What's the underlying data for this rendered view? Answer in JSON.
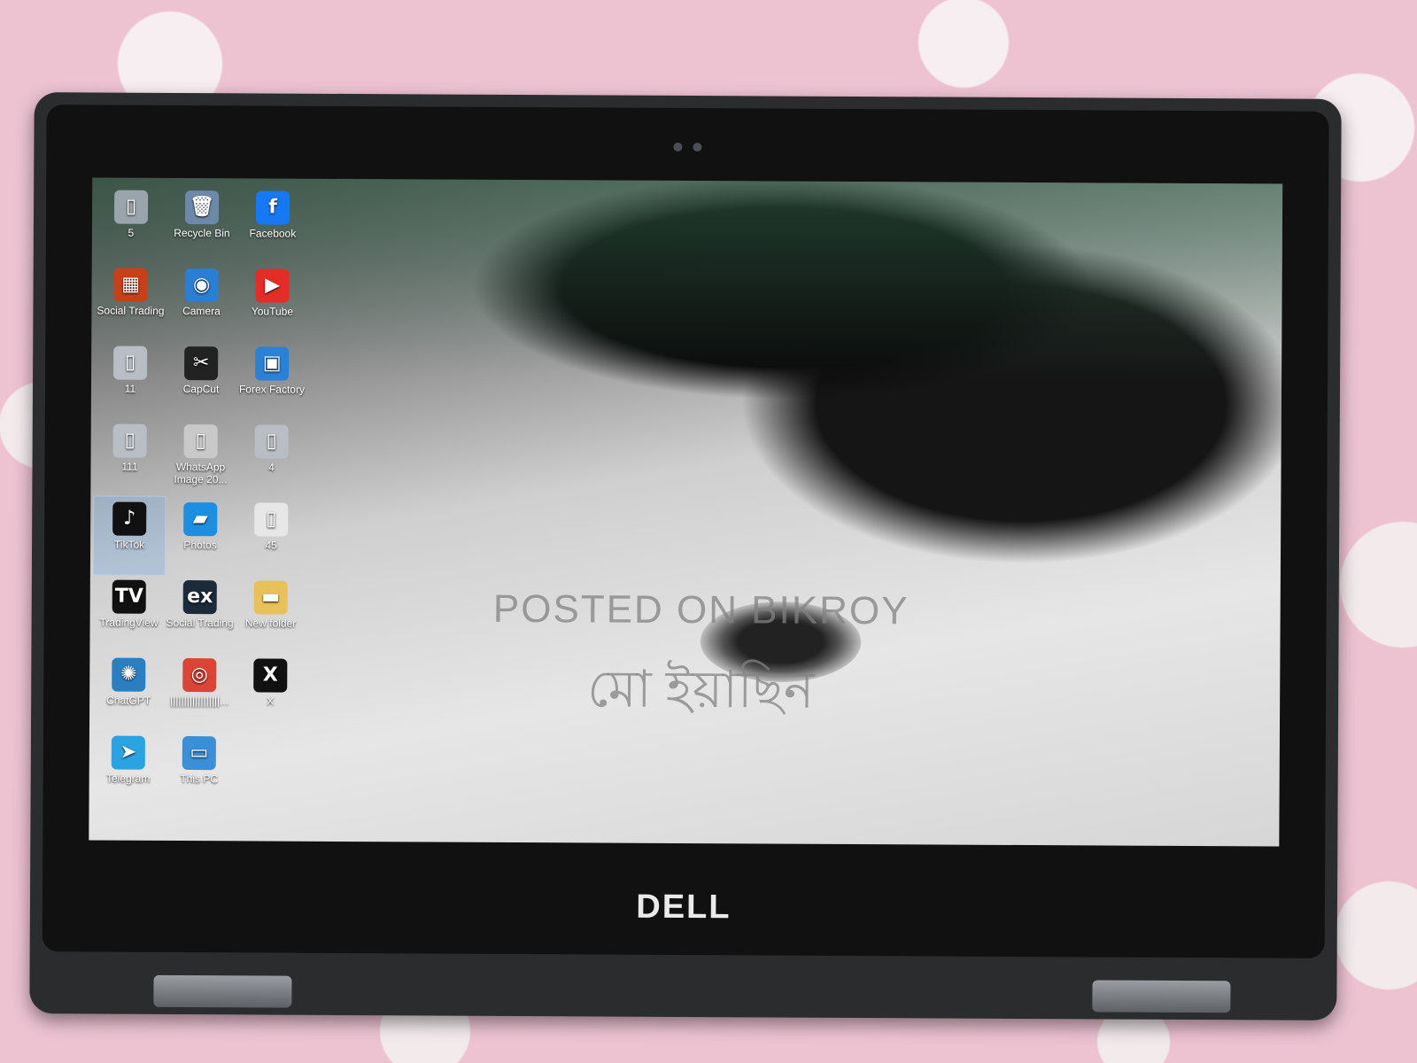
{
  "watermark": {
    "line1": "POSTED ON BIKROY",
    "line2": "মো ইয়াছিন"
  },
  "brand": {
    "logo": "DELL"
  },
  "desktop": {
    "icons": [
      {
        "label": "5",
        "icon": "file-icon",
        "color": "#9aa4ad",
        "glyph": "▯"
      },
      {
        "label": "Recycle Bin",
        "icon": "recycle-bin-icon",
        "color": "#6d88a8",
        "glyph": "🗑"
      },
      {
        "label": "Facebook",
        "icon": "facebook-icon",
        "color": "#1877f2",
        "glyph": "f"
      },
      {
        "label": "Social Trading",
        "icon": "social-trading-icon",
        "color": "#c8401a",
        "glyph": "▦"
      },
      {
        "label": "Camera",
        "icon": "camera-icon",
        "color": "#2a7fd4",
        "glyph": "◉"
      },
      {
        "label": "YouTube",
        "icon": "youtube-icon",
        "color": "#e52d27",
        "glyph": "▶"
      },
      {
        "label": "11",
        "icon": "file-icon",
        "color": "#b9bec4",
        "glyph": "▯"
      },
      {
        "label": "CapCut",
        "icon": "capcut-icon",
        "color": "#222222",
        "glyph": "✂"
      },
      {
        "label": "Forex Factory",
        "icon": "forex-factory-icon",
        "color": "#2a82d6",
        "glyph": "▣"
      },
      {
        "label": "111",
        "icon": "file-icon",
        "color": "#b9bec4",
        "glyph": "▯"
      },
      {
        "label": "WhatsApp Image 20...",
        "icon": "image-file-icon",
        "color": "#c9c9c9",
        "glyph": "▯"
      },
      {
        "label": "4",
        "icon": "file-icon",
        "color": "#b9bec4",
        "glyph": "▯"
      },
      {
        "label": "TikTok",
        "icon": "tiktok-icon",
        "color": "#111111",
        "glyph": "♪"
      },
      {
        "label": "Photos",
        "icon": "photos-icon",
        "color": "#1e8fe0",
        "glyph": "▰"
      },
      {
        "label": "45",
        "icon": "pdf-file-icon",
        "color": "#e7e7e7",
        "glyph": "▯"
      },
      {
        "label": "TradingView",
        "icon": "tradingview-icon",
        "color": "#111111",
        "glyph": "TV"
      },
      {
        "label": "Social Trading",
        "icon": "social-trading-icon",
        "color": "#1b2b3a",
        "glyph": "ex"
      },
      {
        "label": "New folder",
        "icon": "folder-icon",
        "color": "#e8c15a",
        "glyph": "▬"
      },
      {
        "label": "ChatGPT",
        "icon": "chatgpt-icon",
        "color": "#2b7fbf",
        "glyph": "✺"
      },
      {
        "label": "||||||||||||||||||...",
        "icon": "chrome-icon",
        "color": "#db4437",
        "glyph": "◎"
      },
      {
        "label": "X",
        "icon": "x-icon",
        "color": "#111111",
        "glyph": "X"
      },
      {
        "label": "Telegram",
        "icon": "telegram-icon",
        "color": "#2aa3e0",
        "glyph": "➤"
      },
      {
        "label": "This PC",
        "icon": "this-pc-icon",
        "color": "#3b8fd6",
        "glyph": "▭"
      }
    ],
    "selected_label": "TikTok"
  }
}
